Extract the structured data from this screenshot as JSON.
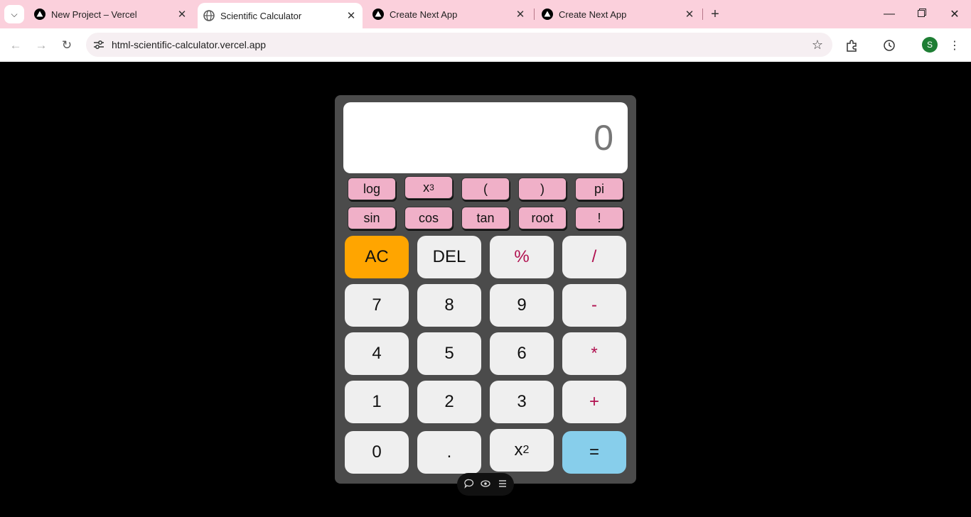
{
  "browser": {
    "tabs": [
      {
        "title": "New Project – Vercel",
        "favicon": "vercel-triangle-icon"
      },
      {
        "title": "Scientific Calculator",
        "favicon": "globe-icon",
        "active": true
      },
      {
        "title": "Create Next App",
        "favicon": "vercel-triangle-icon"
      },
      {
        "title": "Create Next App",
        "favicon": "vercel-triangle-icon"
      }
    ],
    "url": "html-scientific-calculator.vercel.app",
    "profile_initial": "S"
  },
  "calculator": {
    "display": "0",
    "scientific_row1": [
      "log",
      "x",
      "(",
      ")",
      "pi"
    ],
    "cube_exponent": "3",
    "scientific_row2": [
      "sin",
      "cos",
      "tan",
      "root",
      "!"
    ],
    "keys": {
      "ac": "AC",
      "del": "DEL",
      "percent": "%",
      "divide": "/",
      "seven": "7",
      "eight": "8",
      "nine": "9",
      "minus": "-",
      "four": "4",
      "five": "5",
      "six": "6",
      "multiply": "*",
      "one": "1",
      "two": "2",
      "three": "3",
      "plus": "+",
      "zero": "0",
      "dot": ".",
      "square_base": "x",
      "square_exponent": "2",
      "equals": "="
    },
    "colors": {
      "accent_ac": "#ffa500",
      "equals": "#87ceeb",
      "scientific": "#f0b0c8",
      "operator_text": "#b0104f"
    }
  }
}
